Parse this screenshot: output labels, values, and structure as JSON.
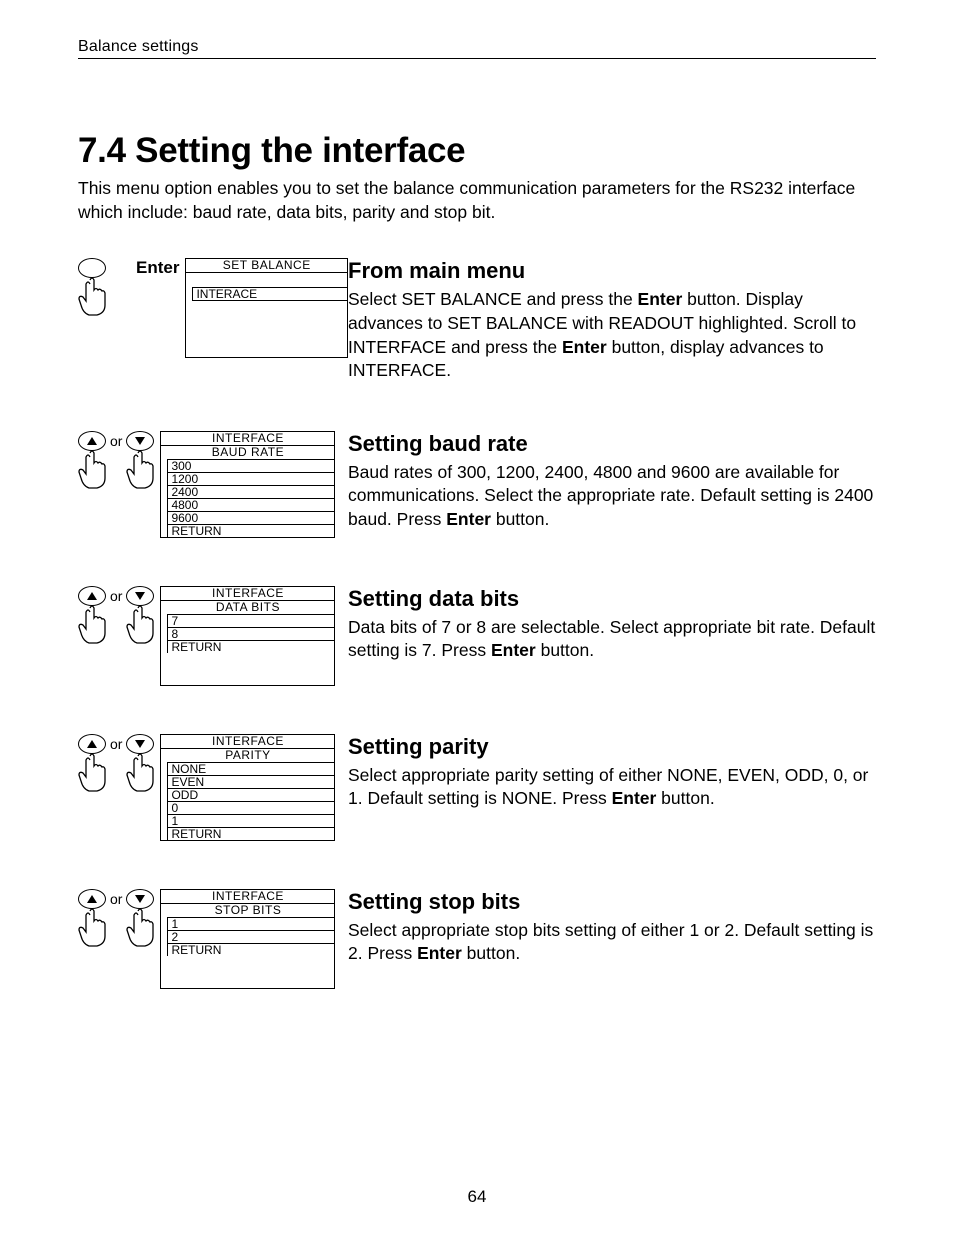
{
  "running_head": "Balance settings",
  "page_number": "64",
  "title": "7.4  Setting the interface",
  "intro_a": "This menu option enables you to set the balance communication parameters for the RS232 interface which include: baud rate, data bits, parity and stop bit.",
  "labels": {
    "enter": "Enter",
    "or": "or"
  },
  "sections": [
    {
      "heading": "From main menu",
      "body_pre": "Select SET BALANCE and press the ",
      "body_bold1": "Enter",
      "body_mid": " button.  Display advances to SET BALANCE with READOUT highlighted.  Scroll to INTERFACE and press the ",
      "body_bold2": "Enter",
      "body_post": " button, display advances to INTERFACE.",
      "lcd": {
        "h1": "SET  BALANCE",
        "single": "INTERACE"
      }
    },
    {
      "heading": "Setting baud rate",
      "body_pre": "Baud rates of 300, 1200, 2400, 4800 and 9600  are available for communications. Select the appropriate rate.  Default setting is 2400 baud. Press ",
      "body_bold1": "Enter",
      "body_post": " button.",
      "lcd": {
        "h1": "INTERFACE",
        "h2": "BAUD RATE",
        "items": [
          "300",
          "1200",
          "2400",
          "4800",
          "9600",
          "RETURN"
        ],
        "filler": "small"
      }
    },
    {
      "heading": "Setting data bits",
      "body_pre": "Data bits of 7 or 8 are selectable.  Select appropriate bit rate.  Default setting is 7.  Press ",
      "body_bold1": "Enter",
      "body_post": " button.",
      "lcd": {
        "h1": "INTERFACE",
        "h2": "DATA BITS",
        "items": [
          "7",
          "8",
          "RETURN"
        ],
        "filler": "mid"
      }
    },
    {
      "heading": "Setting parity",
      "body_pre": "Select appropriate parity setting of either NONE, EVEN, ODD, 0, or 1.  Default setting is NONE.  Press ",
      "body_bold1": "Enter",
      "body_post": " button.",
      "lcd": {
        "h1": "INTERFACE",
        "h2": "PARITY",
        "items": [
          "NONE",
          "EVEN",
          "ODD",
          "0",
          "1",
          "RETURN"
        ],
        "filler": "small"
      }
    },
    {
      "heading": "Setting stop bits",
      "body_pre": "Select appropriate stop bits setting of either 1 or 2.  Default setting is 2.  Press ",
      "body_bold1": "Enter",
      "body_post": " button.",
      "lcd": {
        "h1": "INTERFACE",
        "h2": "STOP BITS",
        "items": [
          "1",
          "2",
          "RETURN"
        ],
        "filler": "mid"
      }
    }
  ]
}
